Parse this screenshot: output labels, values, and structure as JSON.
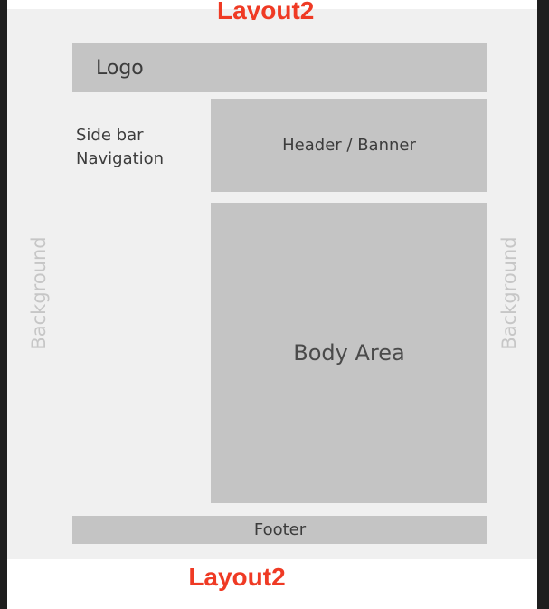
{
  "diagram": {
    "top_title": "Layout2",
    "logo": "Logo",
    "sidebar_lines": [
      "Side bar",
      "Navigation"
    ],
    "header": "Header / Banner",
    "body": "Body Area",
    "footer": "Footer",
    "background_left": "Background",
    "background_right": "Background",
    "bottom_title": "Layout2"
  },
  "colors": {
    "canvas_bg": "#f0f0f0",
    "box_fill": "#c4c4c4",
    "title_red": "#ef3a24",
    "background_label": "#c6c6c6",
    "frame_dark": "#1e1e1e"
  }
}
